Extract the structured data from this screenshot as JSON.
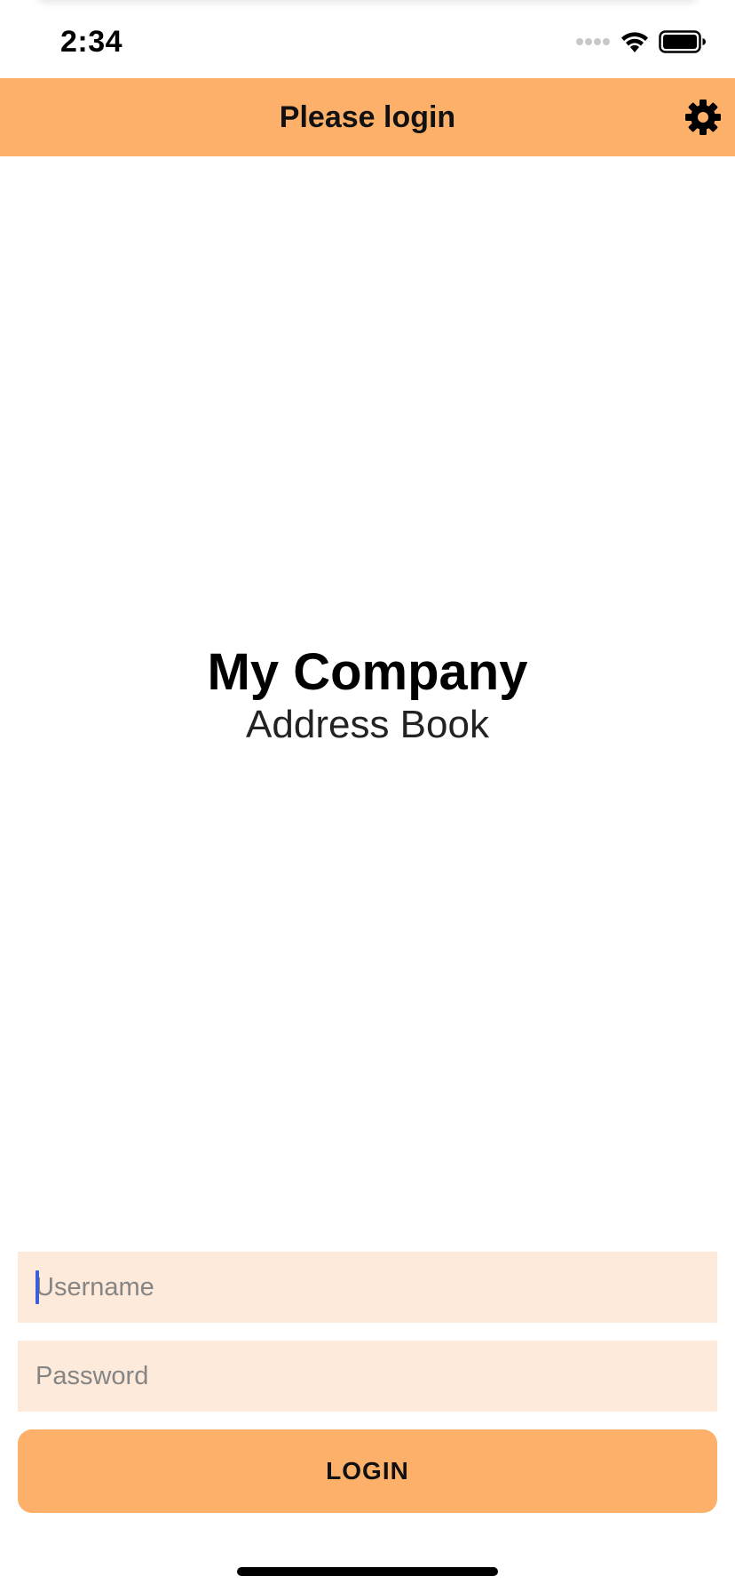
{
  "status_bar": {
    "time": "2:34",
    "icons": [
      "signal-dots-icon",
      "wifi-icon",
      "battery-icon"
    ]
  },
  "nav": {
    "title": "Please login",
    "settings_icon": "gear-icon",
    "background": "#fdb069"
  },
  "brand": {
    "title": "My Company",
    "subtitle": "Address Book"
  },
  "form": {
    "username_placeholder": "Username",
    "username_value": "",
    "password_placeholder": "Password",
    "password_value": "",
    "login_label": "LOGIN",
    "field_background": "#fdeadb",
    "accent": "#fdb069",
    "caret_color": "#3b5fd9"
  }
}
